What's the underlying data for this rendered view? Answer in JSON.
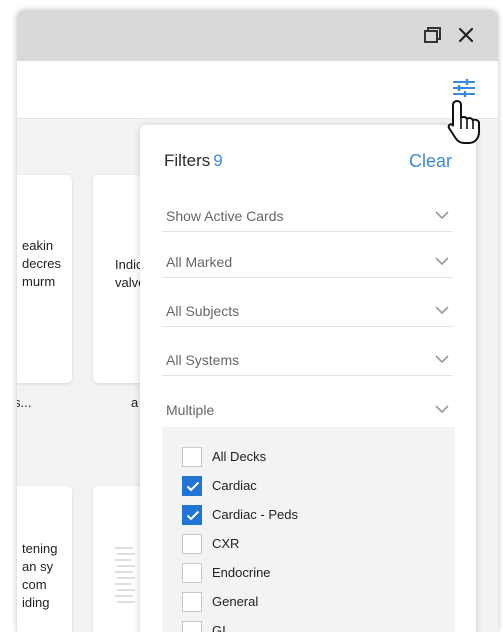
{
  "window": {
    "restore_icon": "restore-window-icon",
    "close_icon": "close-icon"
  },
  "toolbar": {
    "filter_icon": "sliders-icon"
  },
  "cards": [
    {
      "lines": [
        "eakin",
        "decres",
        "murm"
      ],
      "caption": "s..."
    },
    {
      "lines": [
        "Indic",
        "valve"
      ],
      "caption": "a"
    },
    {
      "lines": [
        "tening",
        "an sy",
        "com",
        "iding"
      ],
      "caption": ""
    },
    {
      "lines": [],
      "caption": ""
    }
  ],
  "filters": {
    "title": "Filters",
    "count": "9",
    "clear_label": "Clear",
    "selects": [
      {
        "label": "Show Active Cards"
      },
      {
        "label": "All Marked"
      },
      {
        "label": "All Subjects"
      },
      {
        "label": "All Systems"
      },
      {
        "label": "Multiple"
      }
    ],
    "decks": [
      {
        "label": "All Decks",
        "checked": false
      },
      {
        "label": "Cardiac",
        "checked": true
      },
      {
        "label": "Cardiac - Peds",
        "checked": true
      },
      {
        "label": "CXR",
        "checked": false
      },
      {
        "label": "Endocrine",
        "checked": false
      },
      {
        "label": "General",
        "checked": false
      },
      {
        "label": "GI",
        "checked": false
      }
    ]
  },
  "colors": {
    "accent": "#3b8ad9",
    "checkbox_checked": "#1f74d4"
  }
}
